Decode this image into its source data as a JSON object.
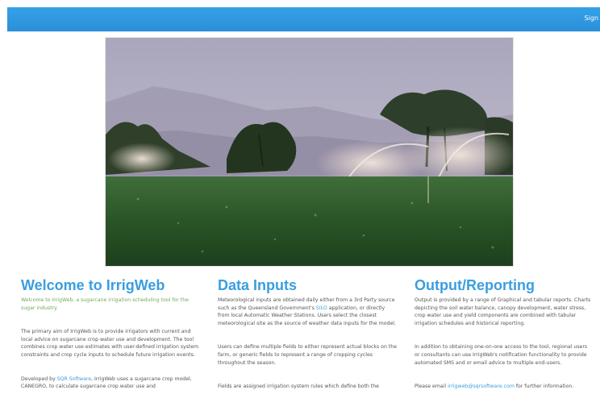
{
  "header": {
    "sign_label": "Sign"
  },
  "hero": {
    "icon": "irrigation-photo"
  },
  "welcome": {
    "title": "Welcome to IrrigWeb",
    "lead": "Welcome to IrrigWeb, a sugarcane irrigation scheduling tool for the sugar industry.",
    "para1": "The primary aim of IrrigWeb is to provide irrigators with current and local advice on sugarcane crop water use and development. The tool combines crop water use estimates with user-defined irrigation system constraints and crop cycle inputs to schedule future irrigation events.",
    "para2_prefix": "Developed by ",
    "para2_link": "SQR Software",
    "para2_suffix": ", IrrigWeb uses a sugarcane crop model, CANEGRO, to calculate sugarcane crop water use and"
  },
  "data_inputs": {
    "title": "Data Inputs",
    "para1_prefix": "Meteorological inputs are obtained daily either from a 3rd Party source such as the Queensland Government's ",
    "para1_link": "SILO",
    "para1_suffix": " application, or directly from local Automatic Weather Stations. Users select the closest meteorological site as the source of weather data inputs for the model.",
    "para2": "Users can define multiple fields to either represent actual blocks on the farm, or generic fields to represent a range of cropping cycles throughout the season.",
    "para3": "Fields are assigned irrigation system rules which define both the"
  },
  "output": {
    "title": "Output/Reporting",
    "para1": "Output is provided by a range of Graphical and tabular reports. Charts depicting the soil water balance, canopy development, water stress, crop water use and yield components are combined with tabular irrigation schedules and historical reporting.",
    "para2": "In addition to obtaining one-on-one access to the tool, regional users or consultants can use IrrigWeb's notification functionality to provide automated SMS and or email advice to multiple end-users.",
    "para3_prefix": "Please email ",
    "para3_link": "irrigweb@sqrsoftware.com",
    "para3_suffix": " for further information."
  }
}
